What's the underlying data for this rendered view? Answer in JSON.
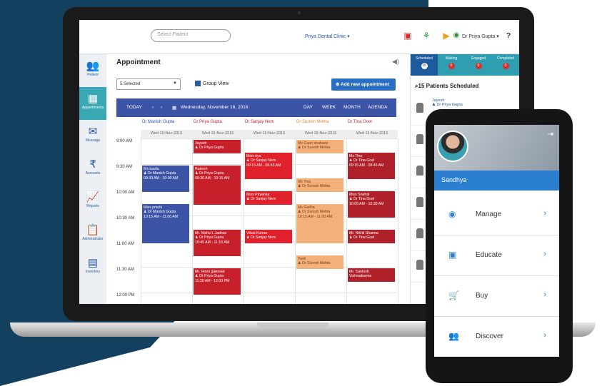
{
  "topbar": {
    "search_placeholder": "Select Patient",
    "clinic": "Priya Dental Clinic ▾",
    "doctor": "Dr Priya Gupta ▾",
    "help": "?"
  },
  "sidebar": {
    "items": [
      {
        "label": "Patient",
        "icon": "patient-icon",
        "glyph": "👥"
      },
      {
        "label": "Appointments",
        "icon": "calendar-icon",
        "glyph": "▦"
      },
      {
        "label": "Message",
        "icon": "message-icon",
        "glyph": "✉"
      },
      {
        "label": "Accounts",
        "icon": "accounts-icon",
        "glyph": "₹"
      },
      {
        "label": "Reports",
        "icon": "reports-icon",
        "glyph": "📈"
      },
      {
        "label": "Administrator",
        "icon": "administrator-icon",
        "glyph": "📋"
      },
      {
        "label": "Inventory",
        "icon": "inventory-icon",
        "glyph": "▤"
      }
    ]
  },
  "main": {
    "title": "Appointment",
    "select_value": "5 Selected",
    "group_view": "Group View",
    "add_button": "Add new appointment",
    "calbar": {
      "today": "TODAY",
      "prev": "‹",
      "next": "›",
      "date": "Wednesday, November 16, 2016",
      "views": [
        "DAY",
        "WEEK",
        "MONTH",
        "AGENDA"
      ]
    },
    "doctors": [
      {
        "name": "Dr Manish Gupta",
        "color": "#2a4db0"
      },
      {
        "name": "Dr Priya Gupta",
        "color": "#c0202a"
      },
      {
        "name": "Dr Sanjay Nem",
        "color": "#c0202a"
      },
      {
        "name": "Dr Suresh Mehta",
        "color": "#e8883a"
      },
      {
        "name": "Dr Tina Goel",
        "color": "#b0303a"
      }
    ],
    "date_label": "Wed 16-Nov-2016",
    "times": [
      "9:00 AM",
      "9:30 AM",
      "10:00 AM",
      "10:30 AM",
      "11:00 AM",
      "11:30 AM",
      "12:00 PM"
    ],
    "appointments": [
      {
        "col": 1,
        "slot": 0.0,
        "len": 0.6,
        "color": "#c8202a",
        "text": "Jayesh\n♟ Dr Priya Gupta"
      },
      {
        "col": 1,
        "slot": 1.0,
        "len": 1.6,
        "color": "#c8202a",
        "text": "Rakesh\n♟ Dr Priya Gupta\n09:30 AM - 10:15 AM"
      },
      {
        "col": 0,
        "slot": 1.0,
        "len": 1.1,
        "color": "#3d53a6",
        "text": "Ms kavita\n♟ Dr Manish Gupta\n09:30 AM - 10:00 AM"
      },
      {
        "col": 0,
        "slot": 2.5,
        "len": 1.6,
        "color": "#3d53a6",
        "text": "Miss prachi\n♟ Dr Manish Gupta\n10:15 AM - 11:00 AM"
      },
      {
        "col": 1,
        "slot": 3.5,
        "len": 1.1,
        "color": "#c8202a",
        "text": "Mr. Nisha L Jadhav\n♟ Dr Priya Gupta\n10:45 AM - 11:15 AM"
      },
      {
        "col": 1,
        "slot": 5.0,
        "len": 1.1,
        "color": "#c8202a",
        "text": "Mr. Hiren gaikwad\n♟ Dr Priya Gupta\n11:30 AM - 12:00 PM"
      },
      {
        "col": 2,
        "slot": 0.5,
        "len": 1.1,
        "color": "#e0202a",
        "text": "Miss riya\n♟ Dr Sanjay Nem\n09:15 AM - 09:45 AM"
      },
      {
        "col": 2,
        "slot": 2.0,
        "len": 0.6,
        "color": "#e0202a",
        "text": "Miss Priyanka\n♟ Dr Sanjay Nem"
      },
      {
        "col": 2,
        "slot": 3.5,
        "len": 0.6,
        "color": "#e0202a",
        "text": "Vikas Kumar\n♟ Dr Sanjay Nem"
      },
      {
        "col": 3,
        "slot": 0.0,
        "len": 0.6,
        "color": "#f4b07a",
        "text": "Ms Gauri shahane\n♟ Dr Suresh Mehta",
        "pale": true
      },
      {
        "col": 3,
        "slot": 1.5,
        "len": 0.6,
        "color": "#f4b07a",
        "text": "Ms Tina\n♟ Dr Suresh Mehta",
        "pale": true
      },
      {
        "col": 3,
        "slot": 2.5,
        "len": 1.6,
        "color": "#f4b07a",
        "text": "Ms Radha\n♟ Dr Suresh Mehta\n10:15 AM - 11:00 AM",
        "pale": true
      },
      {
        "col": 3,
        "slot": 4.5,
        "len": 0.6,
        "color": "#f4b07a",
        "text": "Yash\n♟ Dr Suresh Mehta",
        "pale": true
      },
      {
        "col": 4,
        "slot": 0.5,
        "len": 1.1,
        "color": "#b0202a",
        "text": "Ms Tina\n♟ Dr Tina Goel\n09:15 AM - 09:45 AM"
      },
      {
        "col": 4,
        "slot": 2.0,
        "len": 1.1,
        "color": "#b0202a",
        "text": "Miss Snehal\n♟ Dr Tina Goel\n10:00 AM - 10:30 AM"
      },
      {
        "col": 4,
        "slot": 3.5,
        "len": 0.6,
        "color": "#b0202a",
        "text": "Mr. Nikhil Sharma\n♟ Dr Tina Goel"
      },
      {
        "col": 4,
        "slot": 5.0,
        "len": 0.6,
        "color": "#b0202a",
        "text": "Mr. Santosh\nVishwakarma"
      }
    ]
  },
  "status": {
    "items": [
      {
        "label": "Scheduled",
        "count": "15"
      },
      {
        "label": "Waiting",
        "count": "0"
      },
      {
        "label": "Engaged",
        "count": "0"
      },
      {
        "label": "Completed",
        "count": "0"
      }
    ],
    "heading": "15 Patients Scheduled",
    "patients": [
      {
        "name": "Jayesh",
        "doctor": "♟ Dr Priya Gupta"
      },
      {
        "name": "",
        "doctor": ""
      },
      {
        "name": "",
        "doctor": ""
      },
      {
        "name": "",
        "doctor": ""
      },
      {
        "name": "",
        "doctor": ""
      },
      {
        "name": "",
        "doctor": ""
      }
    ]
  },
  "phone": {
    "user": "Sandhya",
    "menu": [
      {
        "label": "Manage",
        "icon": "manage-icon",
        "glyph": "◉"
      },
      {
        "label": "Educate",
        "icon": "educate-icon",
        "glyph": "▣"
      },
      {
        "label": "Buy",
        "icon": "cart-icon",
        "glyph": "🛒"
      },
      {
        "label": "Discover",
        "icon": "discover-icon",
        "glyph": "👥"
      }
    ],
    "chevron": "›"
  },
  "colors": {
    "accent": "#2a6fc4",
    "header": "#3d53a6",
    "teal": "#2e9eb0",
    "navy": "#13405e"
  }
}
